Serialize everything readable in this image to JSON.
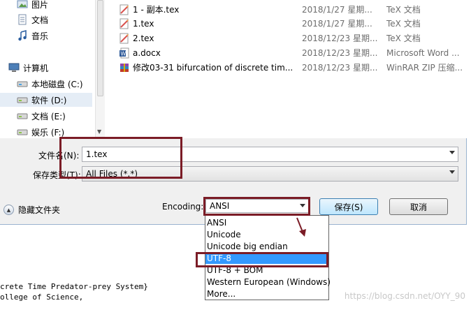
{
  "nav": {
    "items": [
      {
        "label": "图片",
        "icon": "pictures-icon"
      },
      {
        "label": "文档",
        "icon": "documents-icon"
      },
      {
        "label": "音乐",
        "icon": "music-icon"
      },
      {
        "label": "计算机",
        "icon": "computer-icon"
      },
      {
        "label": "本地磁盘 (C:)",
        "icon": "drive-icon"
      },
      {
        "label": "软件 (D:)",
        "icon": "drive-icon"
      },
      {
        "label": "文档 (E:)",
        "icon": "drive-icon"
      },
      {
        "label": "娱乐 (F:)",
        "icon": "drive-icon"
      }
    ]
  },
  "files": [
    {
      "name": "1 - 副本.tex",
      "date": "2018/1/27 星期...",
      "type": "TeX 文档",
      "icon": "tex-file-icon"
    },
    {
      "name": "1.tex",
      "date": "2018/1/27 星期...",
      "type": "TeX 文档",
      "icon": "tex-file-icon"
    },
    {
      "name": "2.tex",
      "date": "2018/12/23 星期...",
      "type": "TeX 文档",
      "icon": "tex-file-icon"
    },
    {
      "name": "a.docx",
      "date": "2018/12/23 星期...",
      "type": "Microsoft Word ...",
      "icon": "word-file-icon"
    },
    {
      "name": "修改03-31 bifurcation of discrete tim...",
      "date": "2018/12/23 星期...",
      "type": "WinRAR ZIP 压缩...",
      "icon": "zip-file-icon"
    }
  ],
  "form": {
    "filename_label": "文件名(N):",
    "filename_value": "1.tex",
    "filetype_label": "保存类型(T):",
    "filetype_value": "All Files (*.*)",
    "hide_folders": "隐藏文件夹",
    "encoding_label": "Encoding:",
    "encoding_value": "ANSI",
    "save_label": "保存(S)",
    "cancel_label": "取消"
  },
  "encoding_options": [
    "ANSI",
    "Unicode",
    "Unicode big endian",
    "UTF-8",
    "UTF-8 + BOM",
    "Western European (Windows)",
    "More..."
  ],
  "selected_encoding_index": 3,
  "background_text": [
    "crete Time Predator-prey System}",
    "ollege of Science,"
  ],
  "watermark": "https://blog.csdn.net/OYY_90",
  "colors": {
    "annotation": "#7b1c26",
    "selection": "#3399ff",
    "nav_selected": "#e5edf6"
  }
}
